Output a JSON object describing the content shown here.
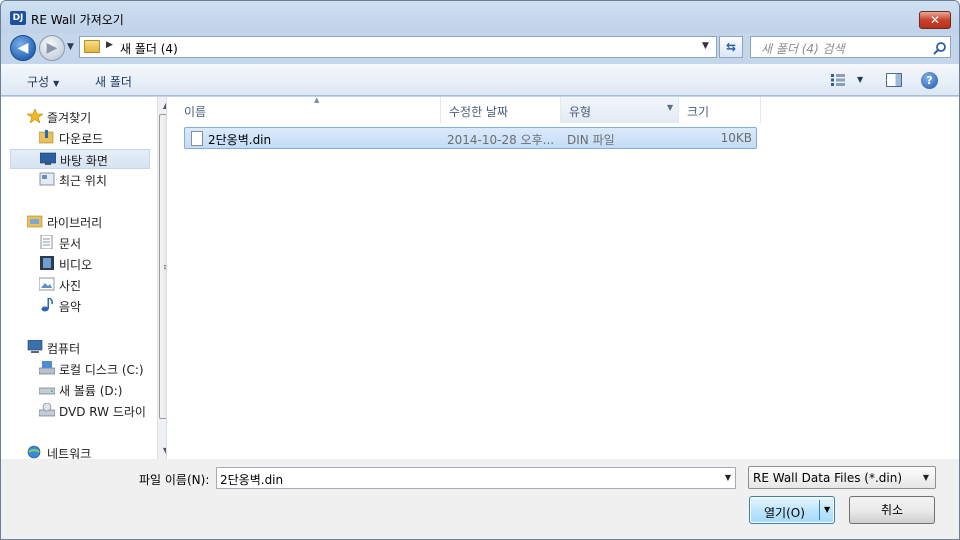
{
  "window": {
    "title": "RE Wall 가져오기",
    "app_icon": "DJ",
    "close_glyph": "✕"
  },
  "navbar": {
    "back_glyph": "◀",
    "forward_glyph": "▶",
    "path": "새 폴더 (4)",
    "search_placeholder": "새 폴더 (4) 검색"
  },
  "toolbar": {
    "organize_label": "구성",
    "new_folder_label": "새 폴더",
    "help_glyph": "?"
  },
  "sidebar": {
    "favorites": {
      "label": "즐겨찾기",
      "items": [
        "다운로드",
        "바탕 화면",
        "최근 위치"
      ],
      "selected": "바탕 화면"
    },
    "libraries": {
      "label": "라이브러리",
      "items": [
        "문서",
        "비디오",
        "사진",
        "음악"
      ]
    },
    "computer": {
      "label": "컴퓨터",
      "items": [
        "로컬 디스크 (C:)",
        "새 볼륨 (D:)",
        "DVD RW 드라이"
      ]
    },
    "network": {
      "label": "네트워크"
    }
  },
  "columns": [
    "이름",
    "수정한 날짜",
    "유형",
    "크기"
  ],
  "files": [
    {
      "name": "2단옹벽.din",
      "modified": "2014-10-28 오후...",
      "type": "DIN 파일",
      "size": "10KB"
    }
  ],
  "bottom": {
    "filename_label": "파일 이름(N):",
    "filename_value": "2단옹벽.din",
    "filter_value": "RE Wall Data Files (*.din)",
    "open_label": "열기(O)",
    "cancel_label": "취소"
  },
  "colors": {
    "accent": "#2a67b8",
    "selection": "#c3dcf6",
    "close": "#c8432b"
  }
}
